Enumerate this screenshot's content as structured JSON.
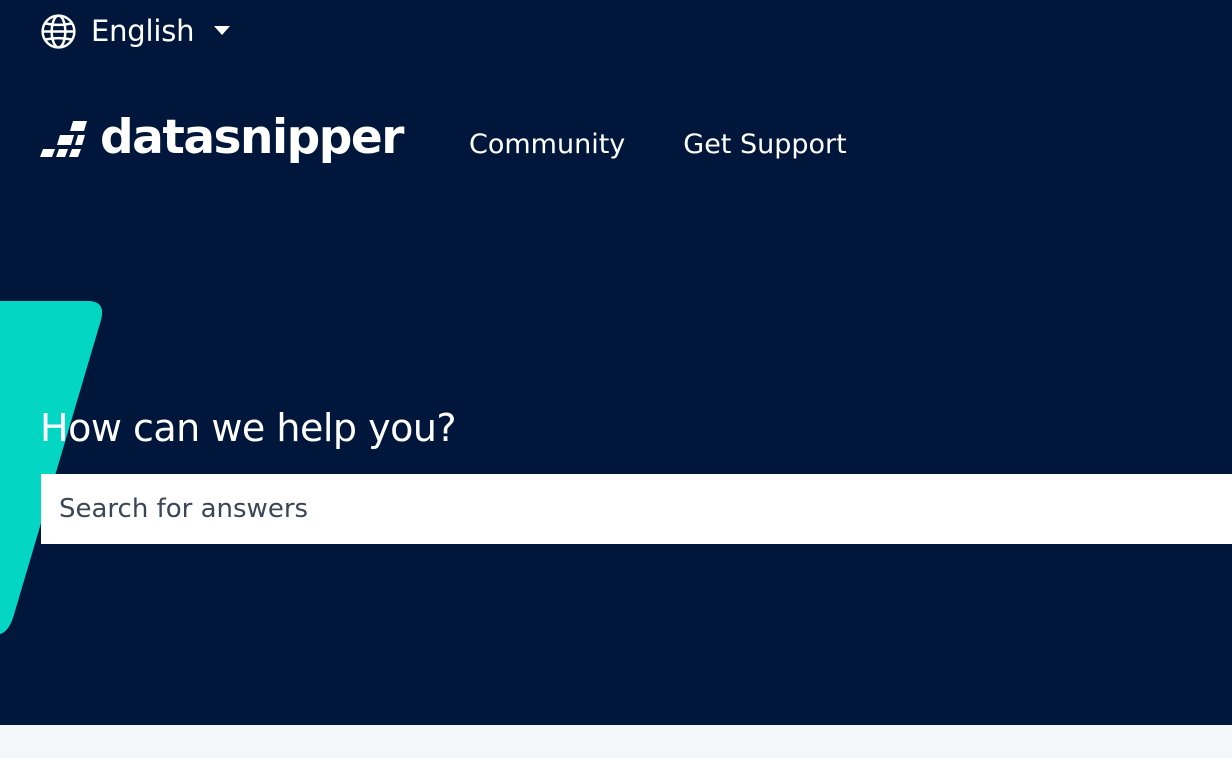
{
  "language": {
    "label": "English",
    "icon": "globe-icon",
    "caret": "caret-down-icon"
  },
  "brand": {
    "name": "datasnipper",
    "icon": "datasnipper-logo-mark-icon"
  },
  "nav": {
    "items": [
      {
        "label": "Community"
      },
      {
        "label": "Get Support"
      }
    ]
  },
  "hero": {
    "title": "How can we help you?"
  },
  "search": {
    "placeholder": "Search for answers"
  },
  "colors": {
    "hero_background": "#00163a",
    "accent": "#04d6c4",
    "text": "#ffffff",
    "page_background": "#f4f7fa"
  }
}
